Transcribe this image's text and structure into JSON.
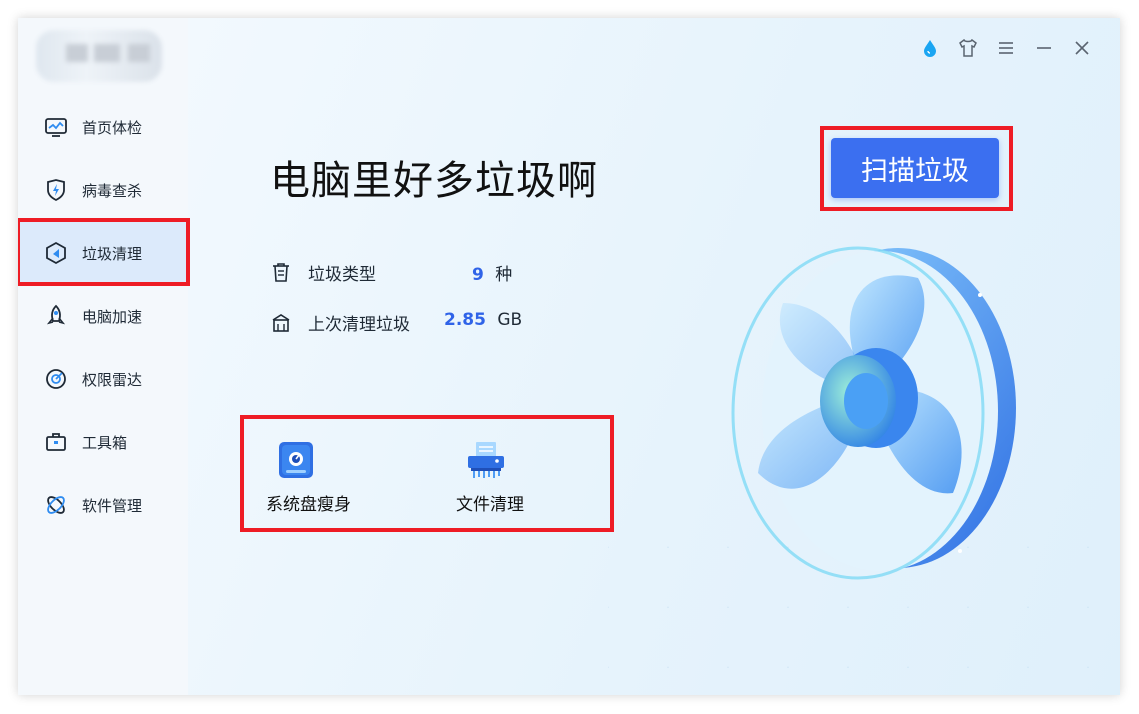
{
  "sidebar": {
    "items": [
      {
        "label": "首页体检",
        "icon": "monitor-icon"
      },
      {
        "label": "病毒查杀",
        "icon": "shield-bolt-icon"
      },
      {
        "label": "垃圾清理",
        "icon": "broom-icon",
        "active": true
      },
      {
        "label": "电脑加速",
        "icon": "rocket-icon"
      },
      {
        "label": "权限雷达",
        "icon": "radar-icon"
      },
      {
        "label": "工具箱",
        "icon": "toolbox-icon"
      },
      {
        "label": "软件管理",
        "icon": "apps-icon"
      }
    ]
  },
  "titlebar": {
    "icons": [
      "drop-icon",
      "shirt-icon",
      "menu-icon",
      "minimize-icon",
      "close-icon"
    ]
  },
  "main": {
    "headline": "电脑里好多垃圾啊",
    "scan_button": "扫描垃圾",
    "stats": [
      {
        "label": "垃圾类型",
        "value": "9",
        "unit": "种",
        "icon": "trash-icon"
      },
      {
        "label": "上次清理垃圾",
        "value": "2.85",
        "unit": "GB",
        "icon": "broom-cart-icon"
      }
    ],
    "tools": [
      {
        "label": "系统盘瘦身",
        "icon": "disk-icon"
      },
      {
        "label": "文件清理",
        "icon": "shredder-icon"
      }
    ]
  },
  "colors": {
    "accent": "#3b6ff0",
    "highlight_box": "#ee1c25",
    "number": "#2f63e8"
  }
}
